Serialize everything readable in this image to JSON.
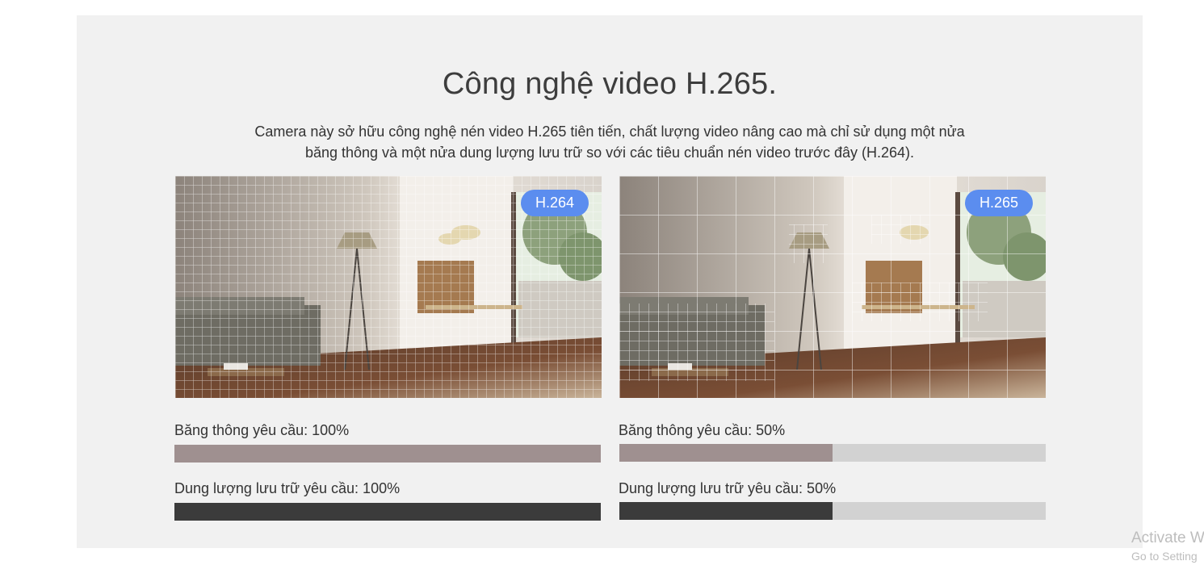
{
  "heading": "Công nghệ video H.265.",
  "description_line1": "Camera này sở hữu công nghệ nén video H.265 tiên tiến, chất lượng video nâng cao mà chỉ sử dụng một nửa",
  "description_line2": "băng thông và một nửa dung lượng lưu trữ so với các tiêu chuẩn nén video trước đây (H.264).",
  "left": {
    "badge": "H.264",
    "bandwidth_label": "Băng thông yêu cầu: 100%",
    "bandwidth_fraction": 1.0,
    "storage_label": "Dung lượng lưu trữ yêu cầu: 100%",
    "storage_fraction": 1.0
  },
  "right": {
    "badge": "H.265",
    "bandwidth_label": "Băng thông yêu cầu: 50%",
    "bandwidth_fraction": 0.5,
    "storage_label": "Dung lượng lưu trữ yêu cầu: 50%",
    "storage_fraction": 0.5
  },
  "colors": {
    "badge": "#5b8def",
    "bandwidth_bar": "#9f9090",
    "storage_bar": "#3b3b3b",
    "bar_track": "#d2d2d2",
    "panel": "#f1f1f1"
  },
  "watermark": {
    "line1": "Activate W",
    "line2": "Go to Setting"
  }
}
